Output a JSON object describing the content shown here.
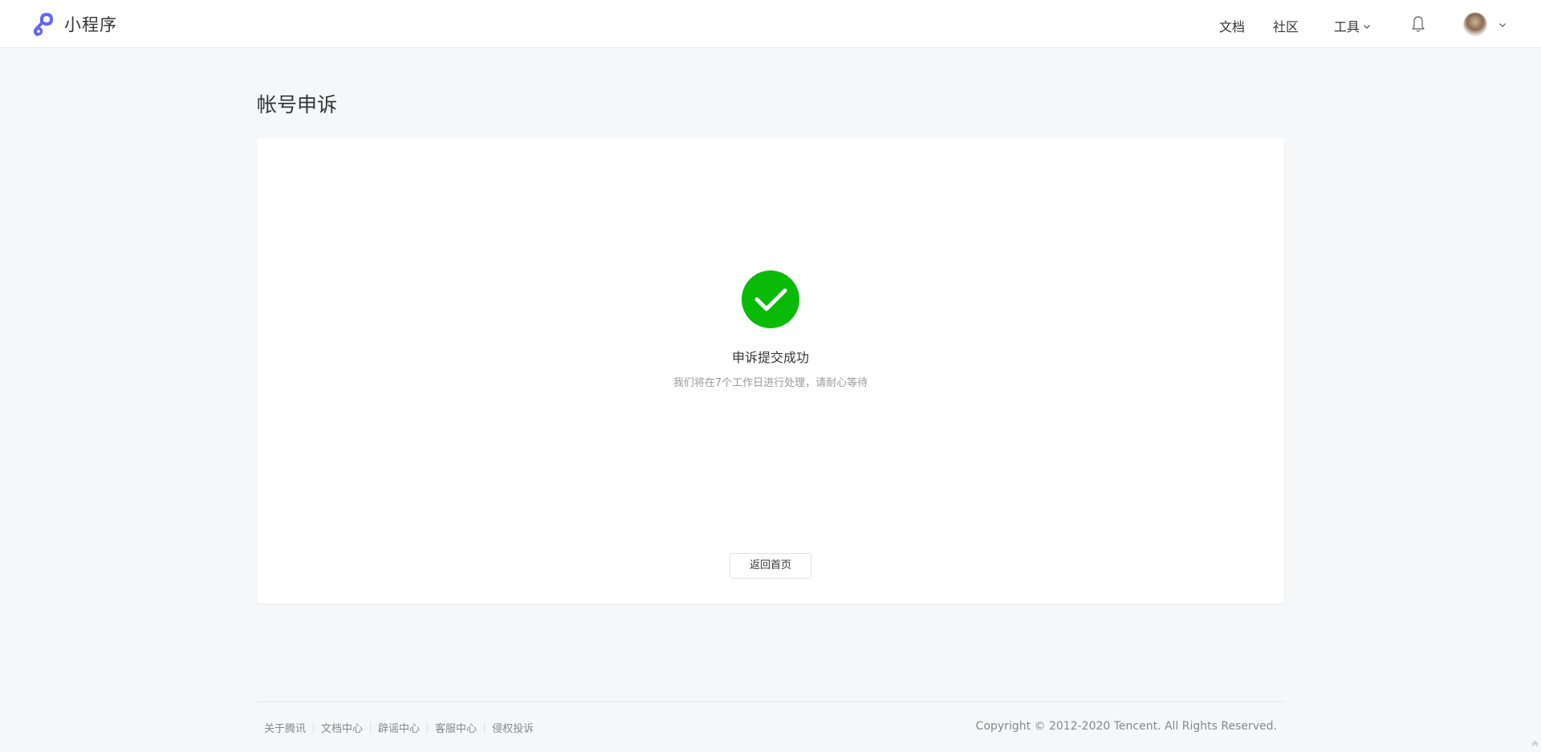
{
  "header": {
    "brand_name": "小程序",
    "nav": {
      "docs": "文档",
      "community": "社区",
      "tools": "工具"
    }
  },
  "page": {
    "title": "帐号申诉"
  },
  "result": {
    "status": "success",
    "title": "申诉提交成功",
    "description": "我们将在7个工作日进行处理，请耐心等待",
    "back_button": "返回首页"
  },
  "footer": {
    "links": [
      "关于腾讯",
      "文档中心",
      "辟谣中心",
      "客服中心",
      "侵权投诉"
    ],
    "copyright": "Copyright © 2012-2020 Tencent. All Rights Reserved."
  },
  "colors": {
    "success": "#09bb07",
    "brand": "#6467f0"
  },
  "icons": {
    "brand": "miniprogram-logo-icon",
    "tools_dropdown": "chevron-down-icon",
    "notifications": "bell-icon",
    "account_dropdown": "chevron-down-icon",
    "result": "checkmark-circle-icon",
    "back_to_top": "back-to-top-icon"
  }
}
